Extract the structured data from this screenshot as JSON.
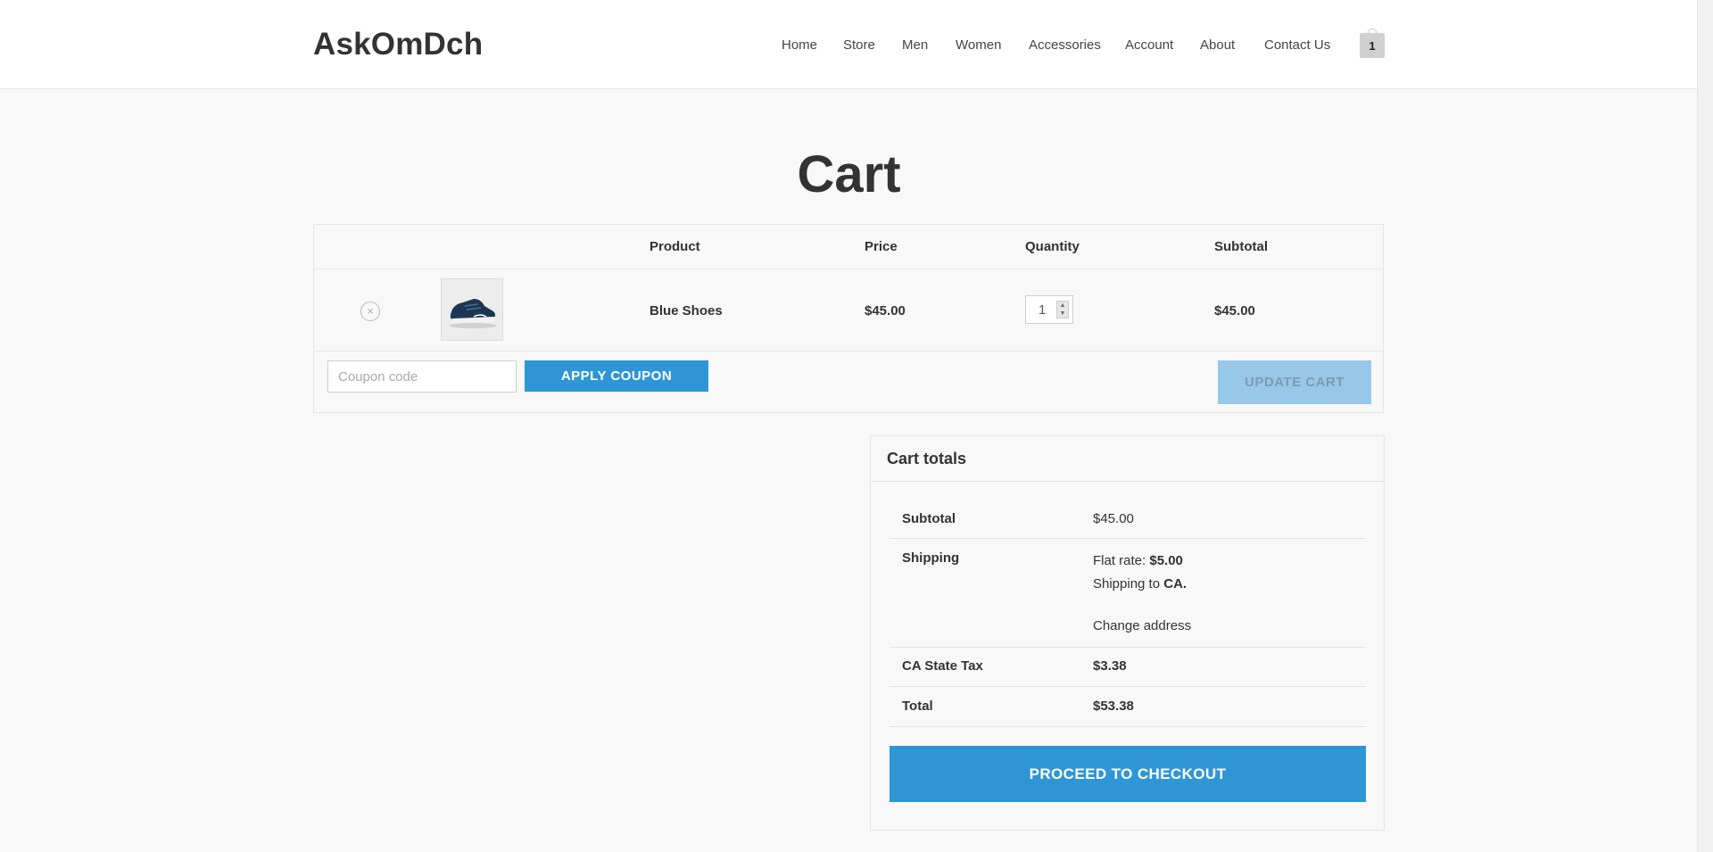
{
  "site": {
    "title": "AskOmDch"
  },
  "nav": {
    "items": [
      {
        "label": "Home"
      },
      {
        "label": "Store"
      },
      {
        "label": "Men"
      },
      {
        "label": "Women"
      },
      {
        "label": "Accessories"
      },
      {
        "label": "Account"
      },
      {
        "label": "About"
      },
      {
        "label": "Contact Us"
      }
    ],
    "cart_count": "1"
  },
  "page": {
    "title": "Cart"
  },
  "cart": {
    "headers": {
      "product": "Product",
      "price": "Price",
      "quantity": "Quantity",
      "subtotal": "Subtotal"
    },
    "items": [
      {
        "name": "Blue Shoes",
        "price": "$45.00",
        "quantity": "1",
        "subtotal": "$45.00",
        "remove_symbol": "×"
      }
    ],
    "coupon": {
      "placeholder": "Coupon code",
      "apply_label": "APPLY COUPON"
    },
    "update_label": "UPDATE CART"
  },
  "totals": {
    "title": "Cart totals",
    "subtotal_label": "Subtotal",
    "subtotal_value": "$45.00",
    "shipping_label": "Shipping",
    "shipping_method_prefix": "Flat rate:",
    "shipping_method_value": "$5.00",
    "shipping_to_prefix": "Shipping to",
    "shipping_to_value": "CA.",
    "change_address": "Change address",
    "tax_label": "CA State Tax",
    "tax_value": "$3.38",
    "total_label": "Total",
    "total_value": "$53.38",
    "checkout_label": "PROCEED TO CHECKOUT"
  },
  "colors": {
    "primary_button": "#2f96d6",
    "disabled_button": "#97c8ea",
    "page_background": "#f8f8f8"
  }
}
